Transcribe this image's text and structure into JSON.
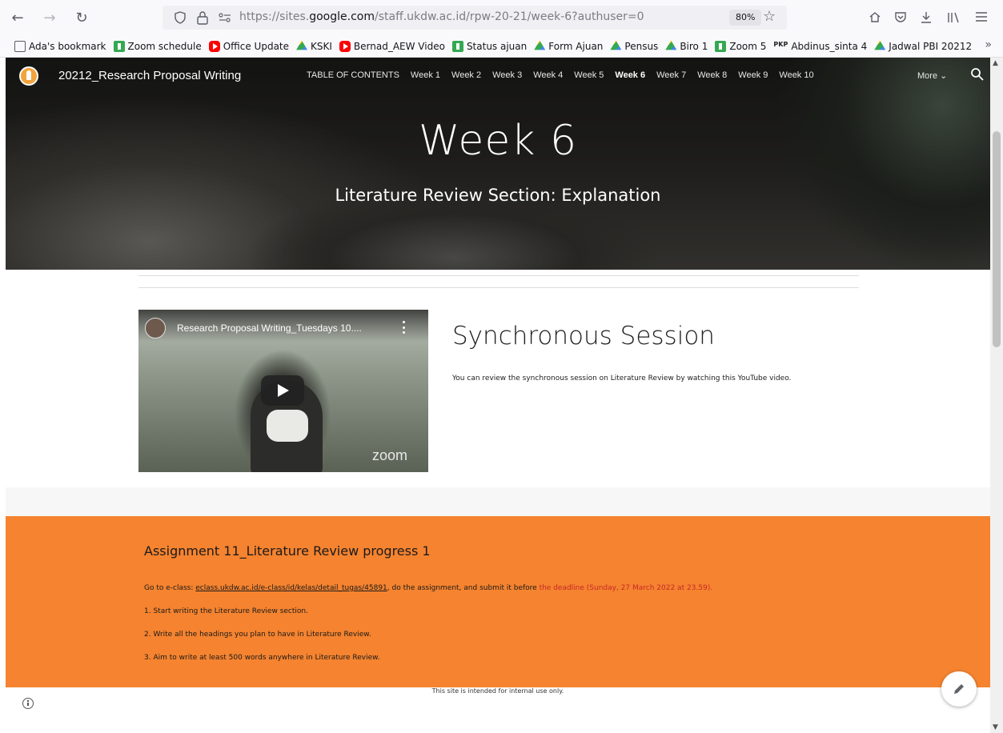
{
  "browser": {
    "url_prefix": "https://sites.",
    "url_domain": "google.com",
    "url_path": "/staff.ukdw.ac.id/rpw-20-21/week-6?authuser=0",
    "zoom": "80%"
  },
  "bookmarks": [
    {
      "label": "Ada's bookmark",
      "icon": "folder-icon"
    },
    {
      "label": "Zoom schedule",
      "icon": "sheets-icon"
    },
    {
      "label": "Office Update",
      "icon": "youtube-icon"
    },
    {
      "label": "KSKI",
      "icon": "drive-icon"
    },
    {
      "label": "Bernad_AEW Video",
      "icon": "youtube-icon"
    },
    {
      "label": "Status ajuan",
      "icon": "sheets-icon"
    },
    {
      "label": "Form Ajuan",
      "icon": "drive-icon"
    },
    {
      "label": "Pensus",
      "icon": "drive-icon"
    },
    {
      "label": "Biro 1",
      "icon": "drive-icon"
    },
    {
      "label": "Zoom 5",
      "icon": "sheets-icon"
    },
    {
      "label": "Abdinus_sinta 4",
      "icon": "pkp-icon",
      "prefix": "PKP"
    },
    {
      "label": "Jadwal PBI 20212",
      "icon": "drive-icon"
    }
  ],
  "site": {
    "title": "20212_Research Proposal Writing",
    "nav": [
      "TABLE OF CONTENTS",
      "Week 1",
      "Week 2",
      "Week 3",
      "Week 4",
      "Week 5",
      "Week 6",
      "Week 7",
      "Week 8",
      "Week 9",
      "Week 10"
    ],
    "active_nav": "Week 6",
    "more": "More"
  },
  "hero": {
    "title": "Week 6",
    "subtitle": "Literature Review Section: Explanation"
  },
  "video": {
    "title": "Research Proposal Writing_Tuesdays 10....",
    "watermark": "zoom"
  },
  "sync": {
    "heading": "Synchronous Session",
    "text": "You can review the synchronous session on Literature Review  by watching this YouTube video."
  },
  "assignment": {
    "title": "Assignment 11_Literature Review progress 1",
    "intro_before": "Go to e-class: ",
    "link": "eclass.ukdw.ac.id/e-class/id/kelas/detail_tugas/45891",
    "intro_after": ", do the assignment, and submit it before ",
    "deadline": "the deadline (Sunday, 27 March 2022 at 23.59).",
    "steps": [
      "1. Start writing the Literature Review section.",
      "2. Write all the headings you plan to have in Literature Review.",
      "3. Aim to write at least 500 words anywhere in Literature Review."
    ]
  },
  "footer": {
    "text": "This site is intended for internal use only."
  },
  "colors": {
    "orange_band": "#f5832f",
    "deadline_red": "#c62828"
  }
}
